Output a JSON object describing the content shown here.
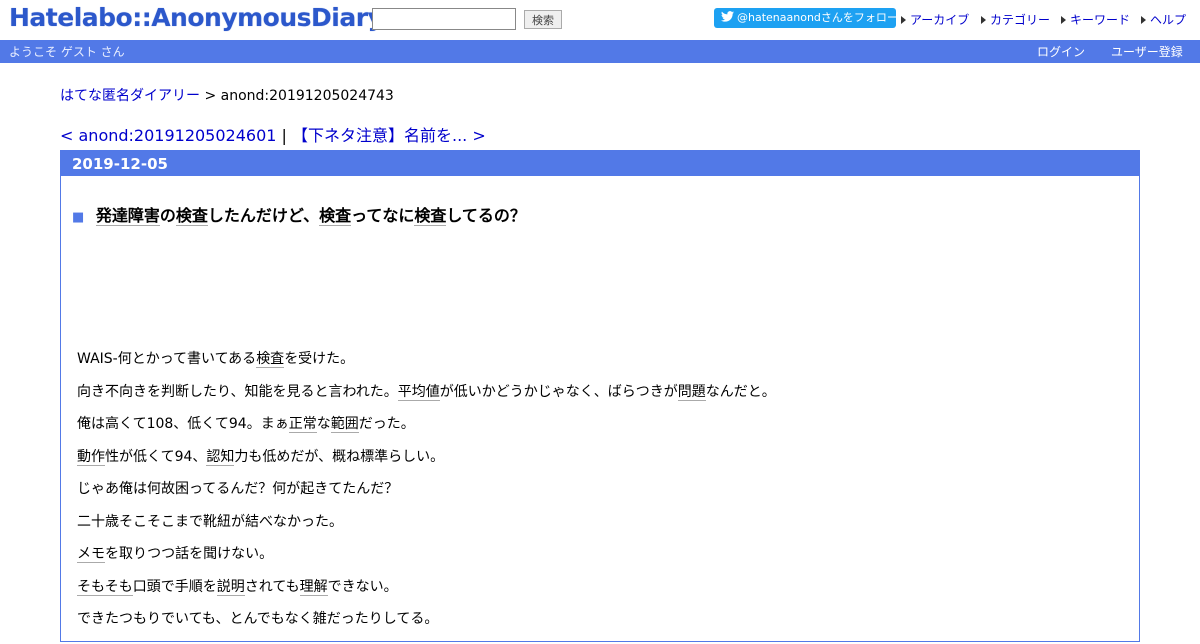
{
  "header": {
    "logo": "Hatelabo::AnonymousDiary",
    "search_placeholder": "",
    "search_button": "検索",
    "follow_button": "@hatenaanondさんをフォロー",
    "nav": [
      "アーカイブ",
      "カテゴリー",
      "キーワード",
      "ヘルプ"
    ]
  },
  "welcome_bar": {
    "welcome": "ようこそ ゲスト さん",
    "login": "ログイン",
    "register": "ユーザー登録"
  },
  "breadcrumb": {
    "home": "はてな匿名ダイアリー",
    "separator": " > ",
    "current": "anond:20191205024743"
  },
  "pager": {
    "prev": "< anond:20191205024601",
    "separator": " | ",
    "next": "【下ネタ注意】名前を... >"
  },
  "day": {
    "date": "2019-12-05",
    "title_marker": "■",
    "title_segments": [
      {
        "text": "発達障害",
        "kw": true
      },
      {
        "text": "の",
        "kw": false
      },
      {
        "text": "検査",
        "kw": true
      },
      {
        "text": "したんだけど、",
        "kw": false
      },
      {
        "text": "検査",
        "kw": true
      },
      {
        "text": "ってなに",
        "kw": false
      },
      {
        "text": "検査",
        "kw": true
      },
      {
        "text": "してるの？",
        "kw": false
      }
    ],
    "paragraphs": [
      [
        {
          "t": "WAIS-何とかって書いてある"
        },
        {
          "t": "検査",
          "kw": true
        },
        {
          "t": "を受けた。"
        }
      ],
      [
        {
          "t": "向き不向きを判断したり、知能を見ると言われた。"
        },
        {
          "t": "平均値",
          "kw": true
        },
        {
          "t": "が低いかどうかじゃなく、ばらつきが"
        },
        {
          "t": "問題",
          "kw": true
        },
        {
          "t": "なんだと。"
        }
      ],
      [
        {
          "t": "俺は高くて108、低くて94。まぁ"
        },
        {
          "t": "正常",
          "kw": true
        },
        {
          "t": "な"
        },
        {
          "t": "範囲",
          "kw": true
        },
        {
          "t": "だった。"
        }
      ],
      [
        {
          "t": "動作",
          "kw": true
        },
        {
          "t": "性が低くて94、"
        },
        {
          "t": "認知",
          "kw": true
        },
        {
          "t": "力も低めだが、概ね標準らしい。"
        }
      ],
      [
        {
          "t": "じゃあ俺は何故困ってるんだ？何が起きてたんだ？"
        }
      ],
      [
        {
          "t": "二十歳そこそこまで靴紐が結べなかった。"
        }
      ],
      [
        {
          "t": "メモ",
          "kw": true
        },
        {
          "t": "を取りつつ話を聞けない。"
        }
      ],
      [
        {
          "t": "そもそも",
          "kw": true
        },
        {
          "t": "口頭で手順を"
        },
        {
          "t": "説明",
          "kw": true
        },
        {
          "t": "されても"
        },
        {
          "t": "理解",
          "kw": true
        },
        {
          "t": "できない。"
        }
      ],
      [
        {
          "t": "できたつもりでいても、とんでもなく雑だったりしてる。"
        }
      ]
    ]
  }
}
